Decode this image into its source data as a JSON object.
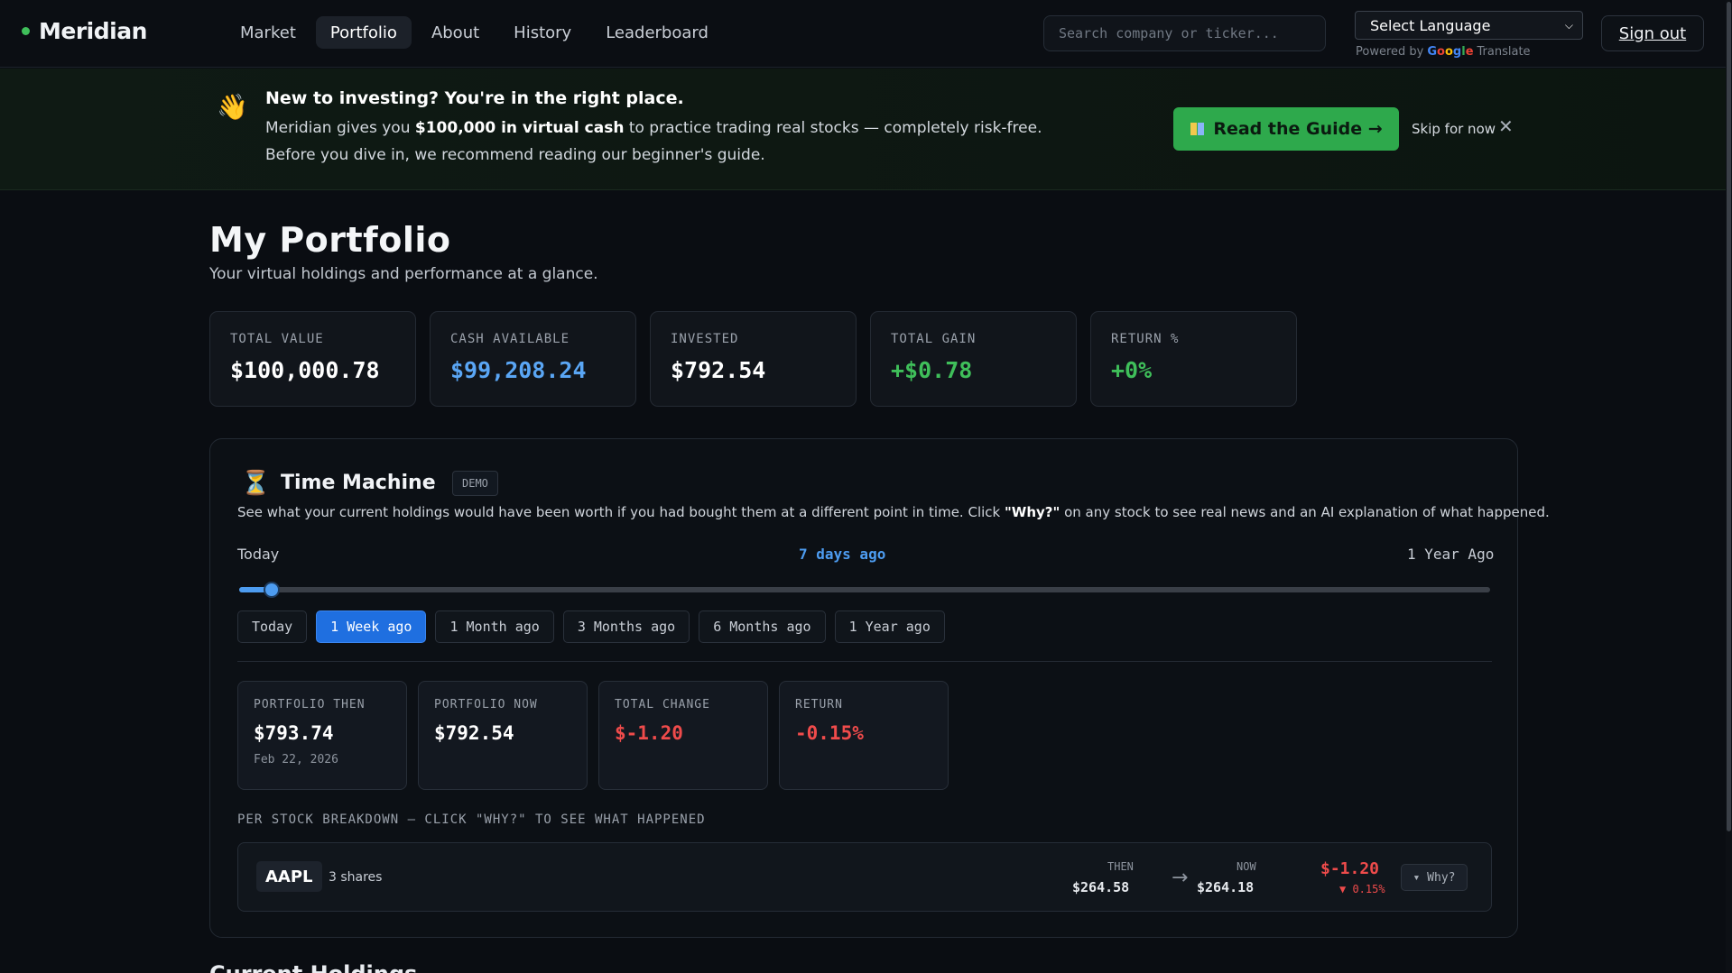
{
  "nav": {
    "logo": "Meridian",
    "items": [
      {
        "label": "Market",
        "active": false
      },
      {
        "label": "Portfolio",
        "active": true
      },
      {
        "label": "About",
        "active": false
      },
      {
        "label": "History",
        "active": false
      },
      {
        "label": "Leaderboard",
        "active": false
      }
    ],
    "search_placeholder": "Search company or ticker...",
    "language_label": "Select Language",
    "powered_by": "Powered by",
    "google": "Google",
    "translate": "Translate",
    "signout": "Sign out"
  },
  "banner": {
    "emoji": "👋",
    "title": "New to investing? You're in the right place.",
    "line1_pre": "Meridian gives you ",
    "line1_bold": "$100,000 in virtual cash",
    "line1_post": " to practice trading real stocks — completely risk-free.",
    "line2": "Before you dive in, we recommend reading our beginner's guide.",
    "guide_button": "Read the Guide →",
    "skip": "Skip for now",
    "close_glyph": "✕"
  },
  "page": {
    "title": "My Portfolio",
    "subtitle": "Your virtual holdings and performance at a glance."
  },
  "stats": [
    {
      "label": "TOTAL VALUE",
      "value": "$100,000.78",
      "tone": "white"
    },
    {
      "label": "CASH AVAILABLE",
      "value": "$99,208.24",
      "tone": "blue"
    },
    {
      "label": "INVESTED",
      "value": "$792.54",
      "tone": "white"
    },
    {
      "label": "TOTAL GAIN",
      "value": "+$0.78",
      "tone": "green"
    },
    {
      "label": "RETURN %",
      "value": "+0%",
      "tone": "green"
    }
  ],
  "time_machine": {
    "icon": "⏳",
    "title": "Time Machine",
    "badge": "DEMO",
    "desc_pre": "See what your current holdings would have been worth if you had bought them at a different point in time. Click ",
    "desc_bold": "\"Why?\"",
    "desc_post": " on any stock to see real news and an AI explanation of what happened.",
    "left_label": "Today",
    "current_label": "7 days ago",
    "right_label": "1 Year Ago",
    "slider_fraction": 0.026,
    "presets": [
      {
        "label": "Today",
        "active": false
      },
      {
        "label": "1 Week ago",
        "active": true
      },
      {
        "label": "1 Month ago",
        "active": false
      },
      {
        "label": "3 Months ago",
        "active": false
      },
      {
        "label": "6 Months ago",
        "active": false
      },
      {
        "label": "1 Year ago",
        "active": false
      }
    ],
    "summary": [
      {
        "label": "PORTFOLIO THEN",
        "value": "$793.74",
        "sub": "Feb 22, 2026",
        "tone": "white"
      },
      {
        "label": "PORTFOLIO NOW",
        "value": "$792.54",
        "sub": "",
        "tone": "white"
      },
      {
        "label": "TOTAL CHANGE",
        "value": "$-1.20",
        "sub": "",
        "tone": "red"
      },
      {
        "label": "RETURN",
        "value": "-0.15%",
        "sub": "",
        "tone": "red"
      }
    ],
    "breakdown_label": "PER STOCK BREAKDOWN — CLICK \"WHY?\" TO SEE WHAT HAPPENED",
    "stocks": [
      {
        "ticker": "AAPL",
        "shares": "3 shares",
        "then_label": "THEN",
        "then": "$264.58",
        "arrow": "→",
        "now_label": "NOW",
        "now": "$264.18",
        "change": "$-1.20",
        "change_pct": "▼ 0.15%",
        "why": "▾ Why?"
      }
    ]
  },
  "next_section": "Current Holdings"
}
